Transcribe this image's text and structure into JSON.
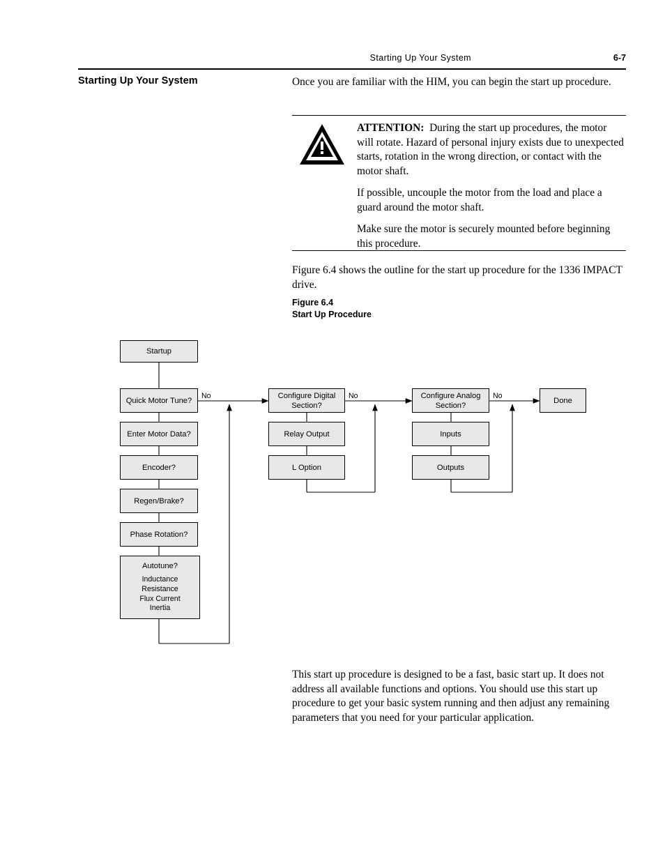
{
  "header": {
    "title": "Starting Up Your System",
    "page_number": "6-7"
  },
  "section": {
    "heading": "Starting Up Your System"
  },
  "intro": {
    "text": "Once you are familiar with the HIM, you can begin the start up procedure."
  },
  "attention": {
    "icon": "warning-triangle-icon",
    "lead": "ATTENTION:",
    "paragraph1": "During the start up procedures, the motor will rotate. Hazard of personal injury exists due to unexpected starts, rotation in the wrong direction, or contact with the motor shaft.",
    "paragraph2": "If possible, uncouple the motor from the load and place a guard around the motor shaft.",
    "paragraph3": "Make sure the motor is securely mounted before beginning this procedure."
  },
  "figure_intro": {
    "text": "Figure 6.4 shows the outline for the start up procedure for the 1336 IMPACT drive."
  },
  "figure_caption": {
    "line1": "Figure 6.4",
    "line2": "Start Up Procedure"
  },
  "flowchart": {
    "nodes": [
      {
        "id": "startup",
        "label": "Startup"
      },
      {
        "id": "quick-motor-tune",
        "label": "Quick Motor Tune?"
      },
      {
        "id": "enter-motor-data",
        "label": "Enter Motor Data?"
      },
      {
        "id": "encoder",
        "label": "Encoder?"
      },
      {
        "id": "regen-brake",
        "label": "Regen/Brake?"
      },
      {
        "id": "phase-rotation",
        "label": "Phase Rotation?"
      },
      {
        "id": "autotune",
        "label": "Autotune?",
        "sub": [
          "Inductance",
          "Resistance",
          "Flux Current",
          "Inertia"
        ]
      },
      {
        "id": "configure-digital-section",
        "label": "Configure Digital Section?"
      },
      {
        "id": "relay-output",
        "label": "Relay Output"
      },
      {
        "id": "l-option",
        "label": "L Option"
      },
      {
        "id": "configure-analog-section",
        "label": "Configure Analog Section?"
      },
      {
        "id": "inputs",
        "label": "Inputs"
      },
      {
        "id": "outputs",
        "label": "Outputs"
      },
      {
        "id": "done",
        "label": "Done"
      }
    ],
    "branch_labels": [
      {
        "id": "no-1",
        "text": "No"
      },
      {
        "id": "no-2",
        "text": "No"
      },
      {
        "id": "no-3",
        "text": "No"
      }
    ]
  },
  "closing": {
    "text": "This start up procedure is designed to be a fast, basic start up. It does not address all available functions and options. You should use this start up procedure to get your basic system running and then adjust any remaining parameters that you need for your particular application."
  }
}
